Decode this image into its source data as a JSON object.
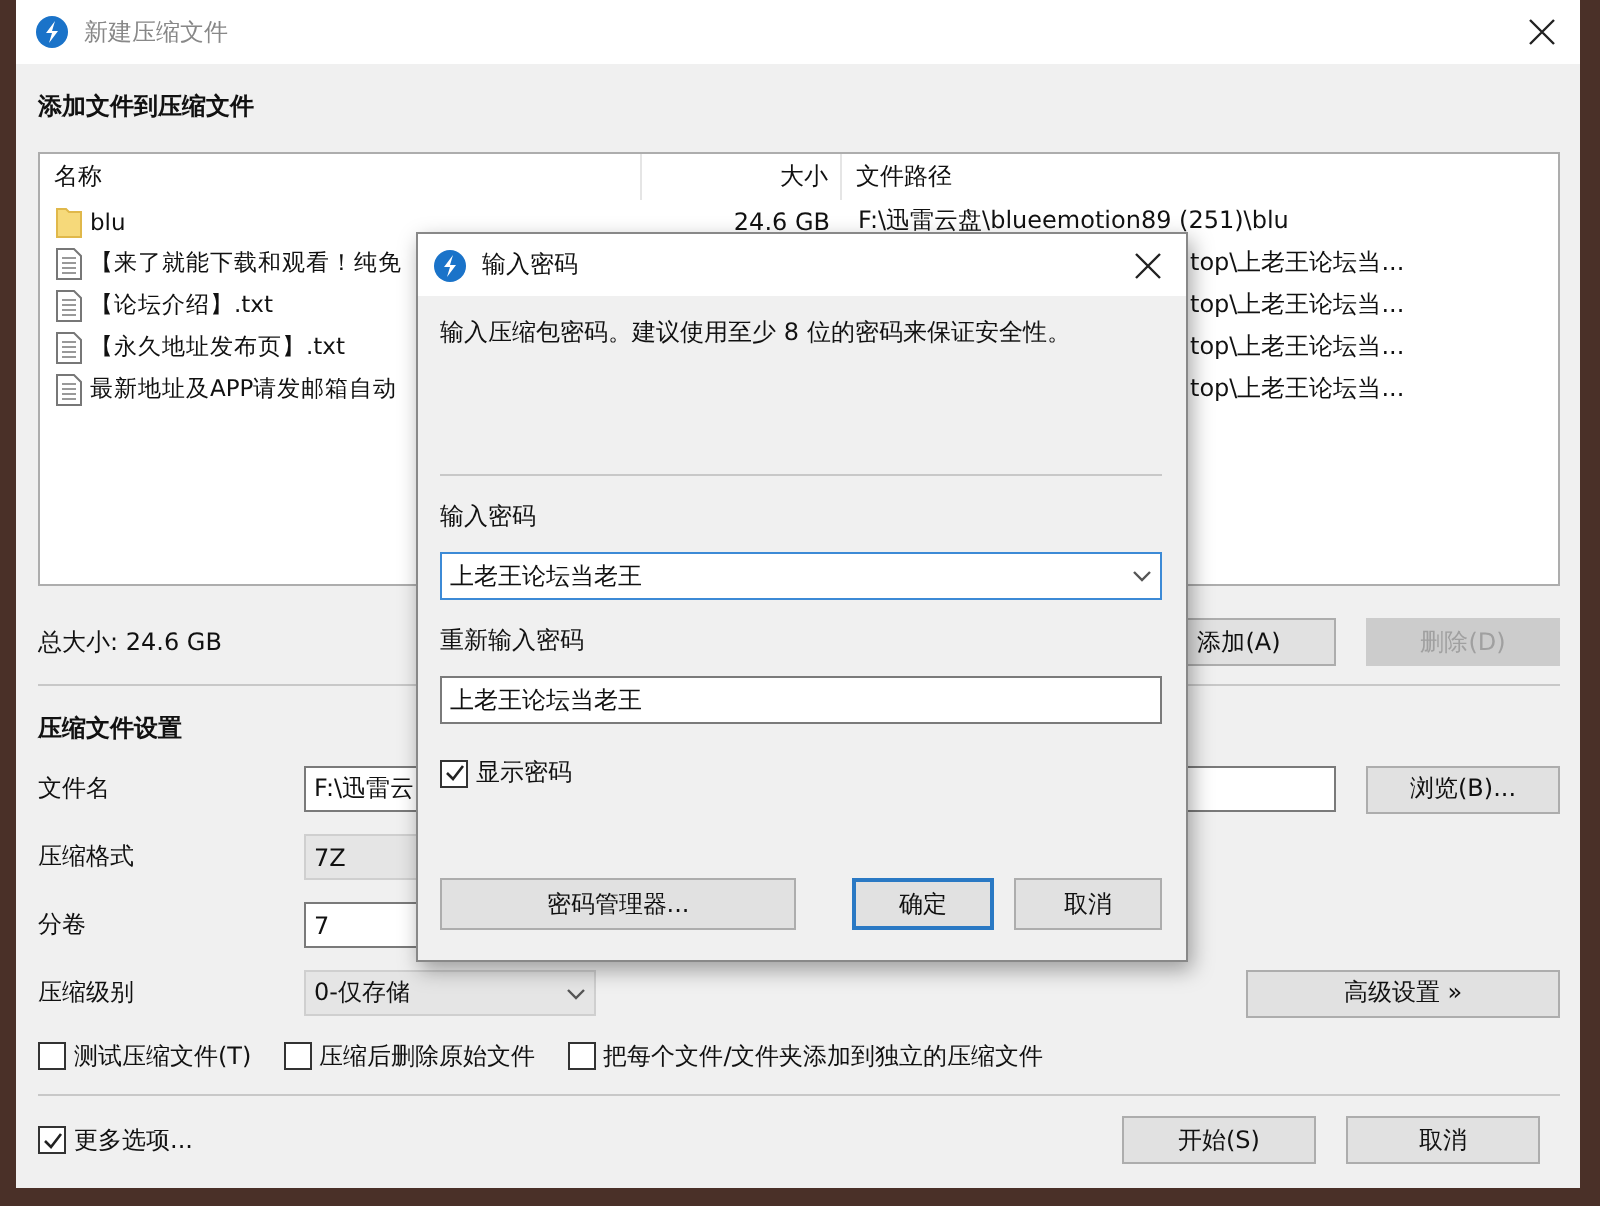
{
  "window": {
    "title": "新建压缩文件"
  },
  "files_section": {
    "heading": "添加文件到压缩文件",
    "columns": [
      "名称",
      "大小",
      "文件路径"
    ],
    "rows": [
      {
        "kind": "folder",
        "name": "blu",
        "size": "24.6 GB",
        "path": "F:\\迅雷云盘\\blueemotion89 (251)\\blu"
      },
      {
        "kind": "file",
        "name": "【来了就能下载和观看！纯免",
        "path": "top\\上老王论坛当..."
      },
      {
        "kind": "file",
        "name": "【论坛介绍】.txt",
        "path": "top\\上老王论坛当..."
      },
      {
        "kind": "file",
        "name": "【永久地址发布页】.txt",
        "path": "top\\上老王论坛当..."
      },
      {
        "kind": "file",
        "name": "最新地址及APP请发邮箱自动",
        "path": "top\\上老王论坛当..."
      }
    ],
    "total": "总大小: 24.6 GB",
    "buttons": [
      {
        "label": "添加(A)",
        "disabled": false
      },
      {
        "label": "删除(D)",
        "disabled": true
      }
    ]
  },
  "settings": {
    "heading": "压缩文件设置",
    "fields": [
      {
        "kind": "text",
        "label": "文件名",
        "value": "F:\\迅雷云"
      },
      {
        "kind": "readonly",
        "label": "压缩格式",
        "value": "7Z"
      },
      {
        "kind": "text",
        "label": "分卷",
        "value": "7"
      },
      {
        "kind": "dropdown",
        "label": "压缩级别",
        "value": "0-仅存储"
      }
    ],
    "browse_button": "浏览(B)...",
    "advanced_button": "高级设置 »",
    "options": [
      {
        "label": "测试压缩文件(T)",
        "checked": false
      },
      {
        "label": "压缩后删除原始文件",
        "checked": false
      },
      {
        "label": "把每个文件/文件夹添加到独立的压缩文件",
        "checked": false
      }
    ]
  },
  "more_options": {
    "label": "更多选项...",
    "checked": true
  },
  "buttons": [
    "开始(S)",
    "取消"
  ],
  "dialog": {
    "title": "输入密码",
    "description": "输入压缩包密码。建议使用至少 8 位的密码来保证安全性。",
    "password_label": "输入密码",
    "password_value": "上老王论坛当老王",
    "confirm_label": "重新输入密码",
    "confirm_value": "上老王论坛当老王",
    "show_password": {
      "label": "显示密码",
      "checked": true
    },
    "buttons": [
      {
        "label": "密码管理器...",
        "default": false
      },
      {
        "label": "确定",
        "default": true
      },
      {
        "label": "取消",
        "default": false
      }
    ]
  }
}
